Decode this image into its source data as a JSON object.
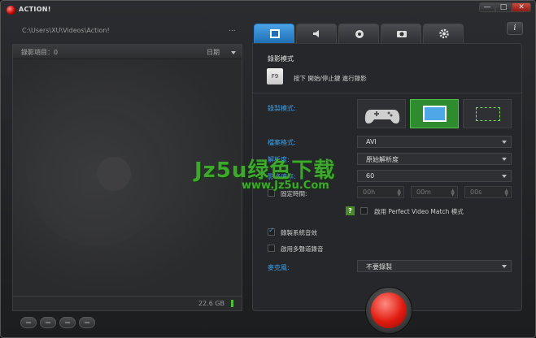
{
  "app": {
    "title": "ACTION!",
    "window_buttons": {
      "minimize": "—",
      "maximize": "□",
      "close": "✕"
    }
  },
  "left": {
    "path": "C:\\Users\\XU\\Videos\\Action!",
    "path_more": "...",
    "list_count": "錄影項目：0",
    "sort_label": "日期",
    "disk_space": "22.6 GB"
  },
  "tabs": [
    {
      "icon": "film-icon",
      "active": true
    },
    {
      "icon": "speaker-icon",
      "active": false
    },
    {
      "icon": "webcam-icon",
      "active": false
    },
    {
      "icon": "camera-icon",
      "active": false
    },
    {
      "icon": "gear-icon",
      "active": false
    }
  ],
  "info_label": "i",
  "settings": {
    "section_title": "錄影模式",
    "hint_key": "F9",
    "hint_text": "按下 開始/停止鍵 進行錄影",
    "record_mode_label": "錄製模式:",
    "file_format_label": "檔案格式:",
    "file_format_value": "AVI",
    "resolution_label": "解析度:",
    "resolution_value": "原始解析度",
    "framerate_label": "影格速率:",
    "framerate_value": "60",
    "fixed_time_label": "固定時間:",
    "time_hours": "00h",
    "time_minutes": "00m",
    "time_seconds": "00s",
    "help_badge": "?",
    "pvm_label": "啟用 Perfect Video Match 模式",
    "system_audio_label": "錄製系統音效",
    "system_audio_checked": true,
    "multitrack_label": "啟用多聲道錄音",
    "multitrack_checked": false,
    "mic_label": "麥克風:",
    "mic_value": "不要錄製"
  },
  "watermark": {
    "main": "Jz5u绿色下载",
    "sub": "www.Jz5u.Com"
  },
  "colors": {
    "accent_blue": "#3d9fe8",
    "active_tab": "#2b7fcf",
    "active_mode": "#2e8b2e",
    "record_red": "#e01b10",
    "watermark_green": "#3ea82e"
  }
}
